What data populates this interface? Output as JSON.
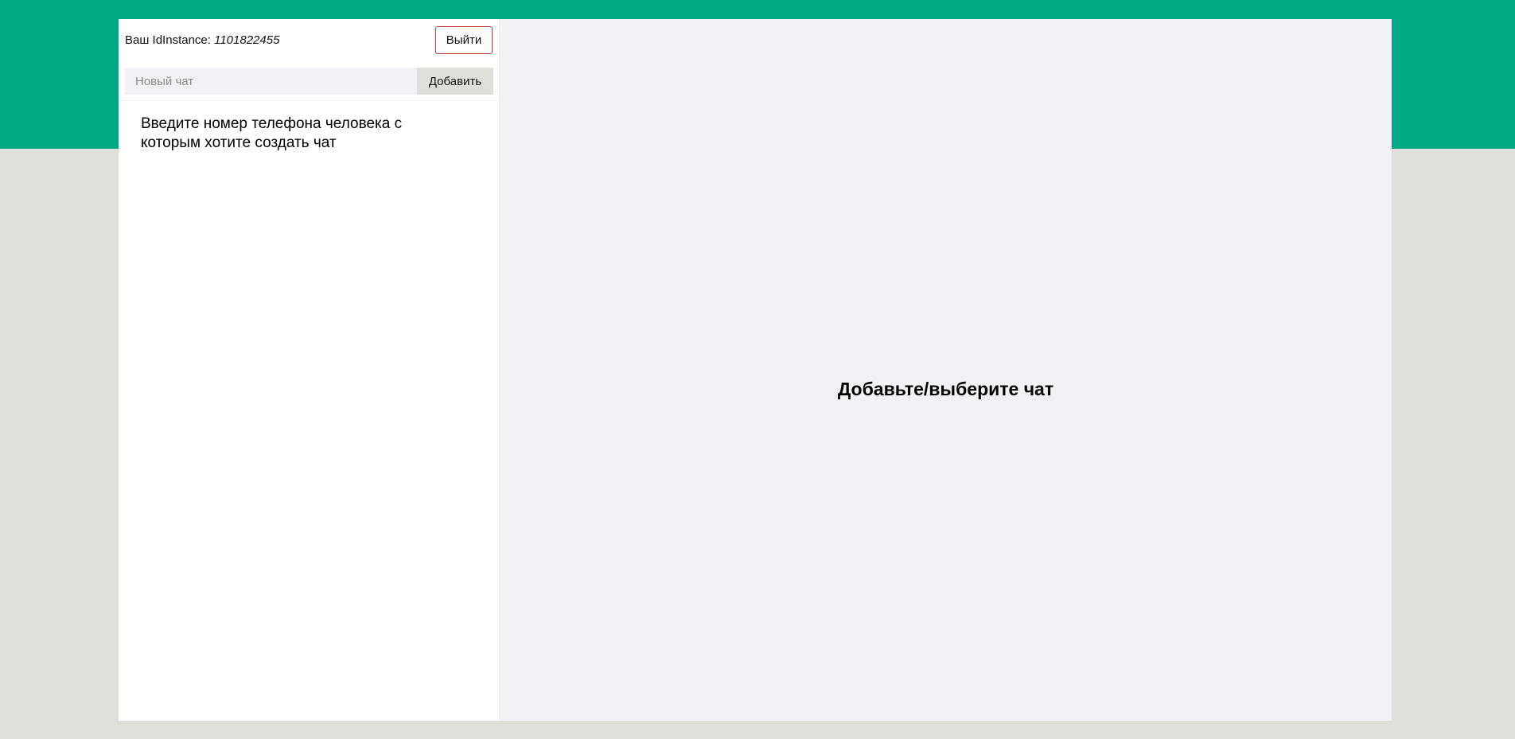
{
  "sidebar": {
    "instance_label": "Ваш IdInstance: ",
    "instance_id": "1101822455",
    "logout_label": "Выйти",
    "new_chat_placeholder": "Новый чат",
    "new_chat_value": "",
    "add_label": "Добавить",
    "hint": "Введите номер телефона человека с которым хотите создать чат"
  },
  "main": {
    "placeholder": "Добавьте/выберите чат"
  },
  "colors": {
    "accent": "#00a884",
    "background": "#dfdfda",
    "pane": "#f0f2f5",
    "logout_border": "#c0392b"
  }
}
